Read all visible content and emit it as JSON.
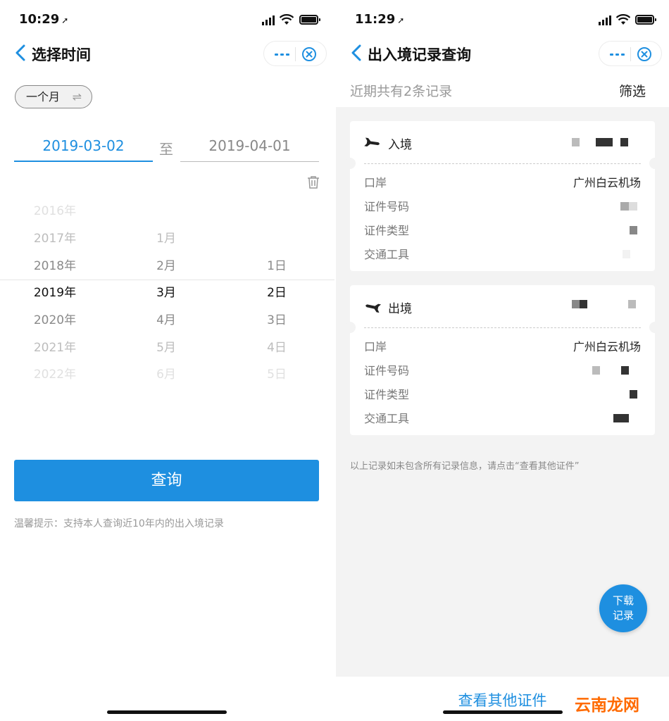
{
  "left": {
    "status": {
      "time": "10:29",
      "arrow": "➚"
    },
    "nav": {
      "title": "选择时间"
    },
    "range_toggle": {
      "label": "一个月",
      "icon": "⇌"
    },
    "date_start": "2019-03-02",
    "to_label": "至",
    "date_end": "2019-04-01",
    "picker": {
      "years": [
        "2016年",
        "2017年",
        "2018年",
        "2019年",
        "2020年",
        "2021年",
        "2022年"
      ],
      "months": [
        "1月",
        "2月",
        "3月",
        "4月",
        "5月",
        "6月"
      ],
      "days": [
        "1日",
        "2日",
        "3日",
        "4日",
        "5日"
      ]
    },
    "query_button": "查询",
    "tip": "温馨提示：支持本人查询近10年内的出入境记录"
  },
  "right": {
    "status": {
      "time": "11:29",
      "arrow": "➚"
    },
    "nav": {
      "title": "出入境记录查询"
    },
    "summary": "近期共有2条记录",
    "filter": "筛选",
    "records": [
      {
        "type": "入境",
        "rows": [
          {
            "key": "口岸",
            "value": "广州白云机场"
          },
          {
            "key": "证件号码",
            "value": ""
          },
          {
            "key": "证件类型",
            "value": ""
          },
          {
            "key": "交通工具",
            "value": ""
          }
        ]
      },
      {
        "type": "出境",
        "rows": [
          {
            "key": "口岸",
            "value": "广州白云机场"
          },
          {
            "key": "证件号码",
            "value": ""
          },
          {
            "key": "证件类型",
            "value": ""
          },
          {
            "key": "交通工具",
            "value": ""
          }
        ]
      }
    ],
    "note": "以上记录如未包含所有记录信息，请点击“查看其他证件”",
    "fab": {
      "line1": "下载",
      "line2": "记录"
    },
    "other_link": "查看其他证件"
  },
  "watermark": "云南龙网",
  "colors": {
    "accent": "#1e8fe0",
    "watermark": "#ff6a00"
  },
  "icons": [
    "back-chevron-icon",
    "more-dots-icon",
    "close-circle-icon",
    "swap-icon",
    "trash-icon",
    "plane-arrival-icon",
    "plane-departure-icon"
  ]
}
